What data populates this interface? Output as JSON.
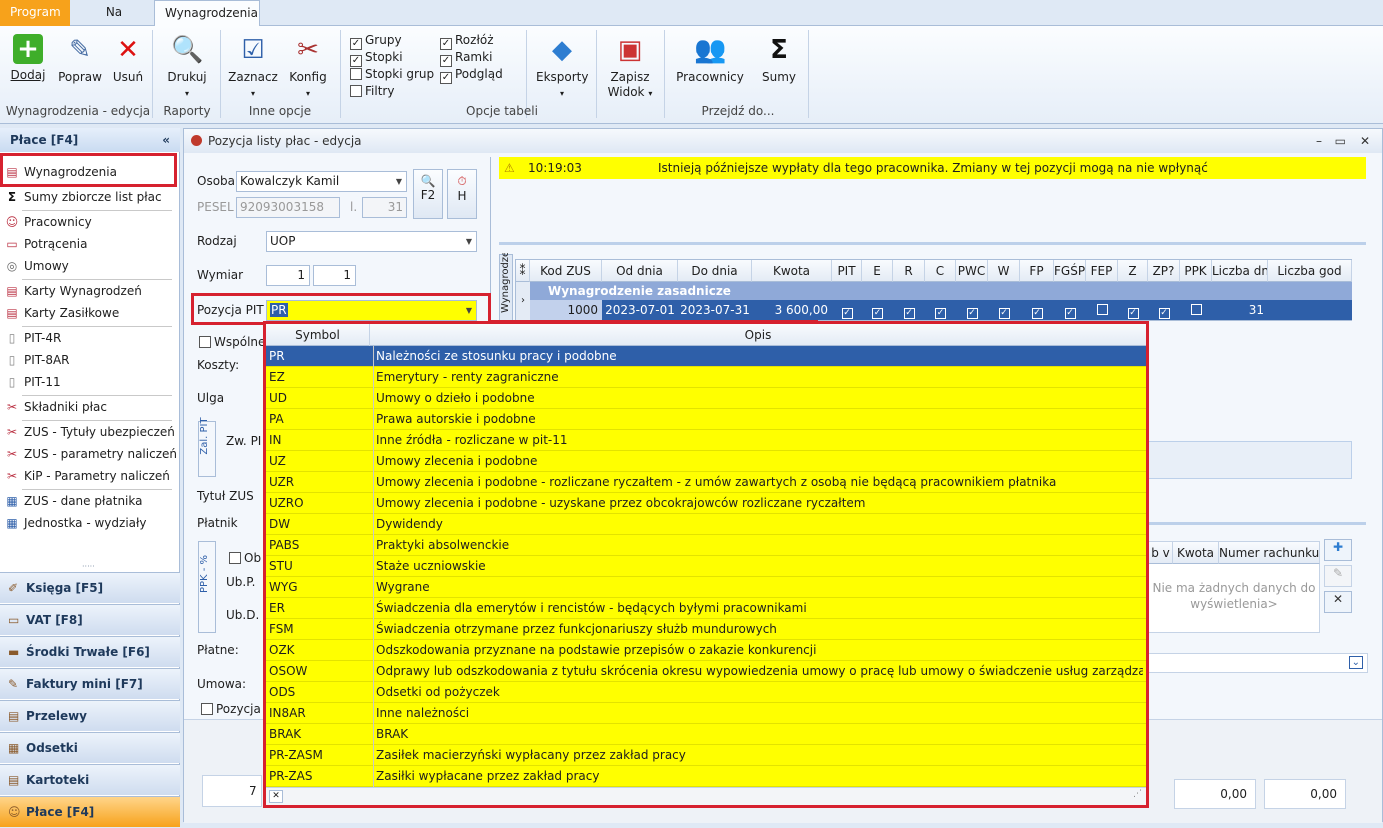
{
  "tabs": {
    "program": "Program",
    "skroty": "Na skróty",
    "wynagrodzenia": "Wynagrodzenia"
  },
  "ribbon": {
    "dodaj": "Dodaj",
    "popraw": "Popraw",
    "usun": "Usuń",
    "drukuj": "Drukuj",
    "zaznacz": "Zaznacz",
    "konfig": "Konfig",
    "opts": {
      "grupy": "Grupy",
      "stopki": "Stopki",
      "stopki_grup": "Stopki grup",
      "filtry": "Filtry",
      "rozloz": "Rozłóż",
      "ramki": "Ramki",
      "podglad": "Podgląd"
    },
    "eksporty": "Eksporty",
    "zapisz": "Zapisz",
    "widok": "Widok",
    "pracownicy": "Pracownicy",
    "sumy": "Sumy",
    "groups": {
      "edycja": "Wynagrodzenia - edycja",
      "raporty": "Raporty",
      "inne": "Inne opcje",
      "opcje": "Opcje tabeli",
      "przejdz": "Przejdź do..."
    }
  },
  "left": {
    "header": "Płace [F4]",
    "collapse": "«",
    "items": [
      "Wynagrodzenia",
      "Sumy zbiorcze list płac",
      "Pracownicy",
      "Potrącenia",
      "Umowy",
      "Karty Wynagrodzeń",
      "Karty Zasiłkowe",
      "PIT-4R",
      "PIT-8AR",
      "PIT-11",
      "Składniki płac",
      "ZUS - Tytuły ubezpieczeń",
      "ZUS - parametry naliczeń",
      "KiP - Parametry naliczeń",
      "ZUS - dane płatnika",
      "Jednostka - wydziały"
    ],
    "nav": [
      "Księga [F5]",
      "VAT [F8]",
      "Środki Trwałe [F6]",
      "Faktury mini [F7]",
      "Przelewy",
      "Odsetki",
      "Kartoteki",
      "Płace [F4]"
    ]
  },
  "window": {
    "title": "Pozycja listy płac - edycja",
    "osoba_label": "Osoba",
    "osoba": "Kowalczyk Kamil",
    "pesel_label": "PESEL",
    "pesel": "92093003158",
    "l_label": "l.",
    "l_value": "31",
    "f2": "F2",
    "h": "H",
    "rodzaj_label": "Rodzaj",
    "rodzaj": "UOP",
    "wymiar_label": "Wymiar",
    "wymiar1": "1",
    "wymiar2": "1",
    "pit_label": "Pozycja PIT",
    "pit": "PR",
    "wspolne": "Wspólne",
    "koszty": "Koszty:",
    "ulga": "Ulga",
    "zal_pit": "Zal. PIT",
    "zw_pit": "Zw. PI",
    "tytul_zus": "Tytuł ZUS",
    "platnik": "Płatnik",
    "ppk": "PPK - %",
    "ob": "Ob",
    "ubp": "Ub.P.",
    "ubd": "Ub.D.",
    "platne": "Płatne:",
    "umowa": "Umowa:",
    "pozycja": "Pozycja",
    "warn_time": "10:19:03",
    "warn_text": "Istnieją późniejsze wypłaty dla tego pracownika. Zmiany w tej pozycji mogą na nie wpłynąć",
    "side_label": "Wynagrodzenia",
    "bottom_num": "7",
    "sum1": "0,00",
    "sum2": "0,00",
    "nodata": "Nie ma żadnych danych do wyświetlenia>",
    "acct_cols": [
      "b v",
      "Kwota",
      "Numer rachunku"
    ]
  },
  "grid": {
    "columns": [
      "Kod ZUS",
      "Od dnia",
      "Do dnia",
      "Kwota",
      "PIT",
      "E",
      "R",
      "C",
      "PWC",
      "W",
      "FP",
      "FGŚP",
      "FEP",
      "Z",
      "ZP?",
      "PPK",
      "Liczba dni",
      "Liczba god"
    ],
    "group": "Wynagrodzenie zasadnicze",
    "row": {
      "kod": "1000",
      "od": "2023-07-01",
      "do": "2023-07-31",
      "kwota": "3 600,00",
      "dni": "31"
    }
  },
  "dropdown": {
    "col_symbol": "Symbol",
    "col_opis": "Opis",
    "rows": [
      {
        "s": "PR",
        "o": "Należności ze stosunku pracy i podobne"
      },
      {
        "s": "EZ",
        "o": "Emerytury - renty zagraniczne"
      },
      {
        "s": "UD",
        "o": "Umowy o dzieło i podobne"
      },
      {
        "s": "PA",
        "o": "Prawa autorskie i podobne"
      },
      {
        "s": "IN",
        "o": "Inne źródła - rozliczane w pit-11"
      },
      {
        "s": "UZ",
        "o": "Umowy zlecenia i podobne"
      },
      {
        "s": "UZR",
        "o": "Umowy zlecenia i podobne - rozliczane ryczałtem - z umów zawartych z osobą nie będącą pracownikiem płatnika"
      },
      {
        "s": "UZRO",
        "o": "Umowy zlecenia i podobne - uzyskane przez obcokrajowców rozliczane ryczałtem"
      },
      {
        "s": "DW",
        "o": "Dywidendy"
      },
      {
        "s": "PABS",
        "o": "Praktyki absolwenckie"
      },
      {
        "s": "STU",
        "o": "Staże uczniowskie"
      },
      {
        "s": "WYG",
        "o": "Wygrane"
      },
      {
        "s": "ER",
        "o": "Świadczenia dla emerytów i rencistów - będących byłymi pracownikami"
      },
      {
        "s": "FSM",
        "o": "Świadczenia otrzymane przez funkcjonariuszy służb mundurowych"
      },
      {
        "s": "OZK",
        "o": "Odszkodowania przyznane na podstawie przepisów o zakazie konkurencji"
      },
      {
        "s": "OSOW",
        "o": "Odprawy lub odszkodowania z tytułu skrócenia okresu wypowiedzenia umowy o pracę lub umowy o świadczenie usług zarządzania"
      },
      {
        "s": "ODS",
        "o": "Odsetki od pożyczek"
      },
      {
        "s": "IN8AR",
        "o": "Inne należności"
      },
      {
        "s": "BRAK",
        "o": "BRAK"
      },
      {
        "s": "PR-ZASM",
        "o": "Zasiłek macierzyński wypłacany przez zakład pracy"
      },
      {
        "s": "PR-ZAS",
        "o": "Zasiłki wypłacane przez zakład pracy"
      }
    ]
  }
}
